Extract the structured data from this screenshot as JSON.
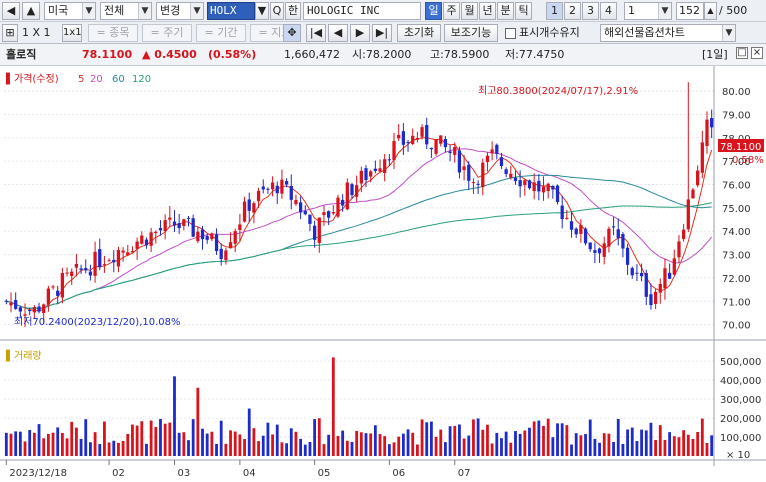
{
  "toolbar": {
    "back_icon": "back-arrow-icon",
    "up_icon": "up-arrow-icon",
    "market": "미국",
    "scope": "전체",
    "change": "변경",
    "ticker": "HOLX",
    "search_icon": "search-icon",
    "lang": "한",
    "stock_name": "HOLOGIC INC",
    "periods": [
      "일",
      "주",
      "월",
      "년",
      "분",
      "틱"
    ],
    "selected_period": "일",
    "pages": [
      "1",
      "2",
      "3",
      "4"
    ],
    "selected_page": "1",
    "interval": "1",
    "count": "152",
    "total": "/ 500"
  },
  "toolbar2": {
    "grid_label": "1 X 1",
    "one_label": "1x1",
    "items": [
      "= 종목",
      "= 주기",
      "= 기간",
      "= 지표"
    ],
    "move_icon": "move-icon",
    "reset": "초기화",
    "aux": "보조기능",
    "keep_label": "표시개수유지",
    "futures": "해외선물옵션차트"
  },
  "info": {
    "name": "홀로직",
    "price": "78.1100",
    "change": "▲ 0.4500",
    "change_pct": "(0.58%)",
    "volume": "1,660,472",
    "open": "시:78.2000",
    "high": "고:78.5900",
    "low": "저:77.4750",
    "count_label": "[1일]"
  },
  "price_panel": {
    "legend_title": "가격(수정)",
    "ma": [
      {
        "label": "5",
        "color": "#e0321e"
      },
      {
        "label": "20",
        "color": "#c050c8"
      },
      {
        "label": "60",
        "color": "#2a8a9a"
      },
      {
        "label": "120",
        "color": "#2aa07a"
      }
    ],
    "current_price": "78.1100",
    "current_pct": "0.58%",
    "max_annotation": "최고80.3800(2024/07/17),2.91%",
    "min_annotation": "최저70.2400(2023/12/20),10.08%"
  },
  "volume_panel": {
    "legend_title": "거래량",
    "multiplier": "× 10"
  },
  "x_axis": [
    "2023/12/18",
    "02",
    "03",
    "04",
    "05",
    "06",
    "07"
  ],
  "chart_data": [
    {
      "type": "candlestick",
      "title": "가격(수정)",
      "y_ticks": [
        70.0,
        71.0,
        72.0,
        73.0,
        74.0,
        75.0,
        76.0,
        77.0,
        78.0,
        79.0,
        80.0
      ],
      "ylim": [
        69.6,
        80.9
      ],
      "series": [
        {
          "name": "5",
          "color": "#e0321e"
        },
        {
          "name": "20",
          "color": "#c050c8"
        },
        {
          "name": "60",
          "color": "#2a8a9a"
        },
        {
          "name": "120",
          "color": "#2aa07a"
        }
      ],
      "max": 80.38,
      "min": 70.24,
      "last": 78.11
    },
    {
      "type": "bar",
      "title": "거래량",
      "y_ticks": [
        100000,
        200000,
        300000,
        400000,
        500000
      ],
      "y_tick_labels": [
        "100,000",
        "200,000",
        "300,000",
        "400,000",
        "500,000"
      ],
      "ylim": [
        0,
        580000
      ]
    }
  ],
  "colors": {
    "up": "#d8131b",
    "down": "#1c2bc9",
    "accent": "#2f5fb9"
  }
}
